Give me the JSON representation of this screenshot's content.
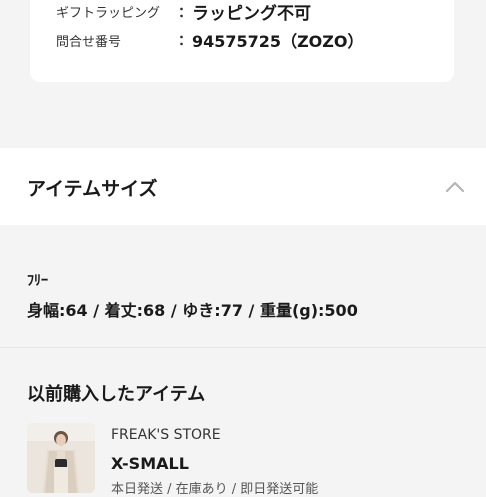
{
  "shipping_info": {
    "gift_wrapping": {
      "label": "ギフトラッピング",
      "colon": "：",
      "value": "ラッピング不可"
    },
    "inquiry_number": {
      "label": "問合せ番号",
      "colon": "：",
      "value": "94575725（ZOZO）"
    }
  },
  "item_size_section": {
    "title": "アイテムサイズ",
    "collapse_icon": "chevron-up-icon",
    "size_name": "ﾌﾘｰ",
    "measurements": "身幅:64 / 着丈:68 / ゆき:77 / 重量(g):500"
  },
  "purchase_history": {
    "title": "以前購入したアイテム",
    "items": [
      {
        "brand": "FREAK'S STORE",
        "size": "X-SMALL",
        "description": "本日発送 / 在庫あり / 即日発送可能"
      }
    ]
  }
}
